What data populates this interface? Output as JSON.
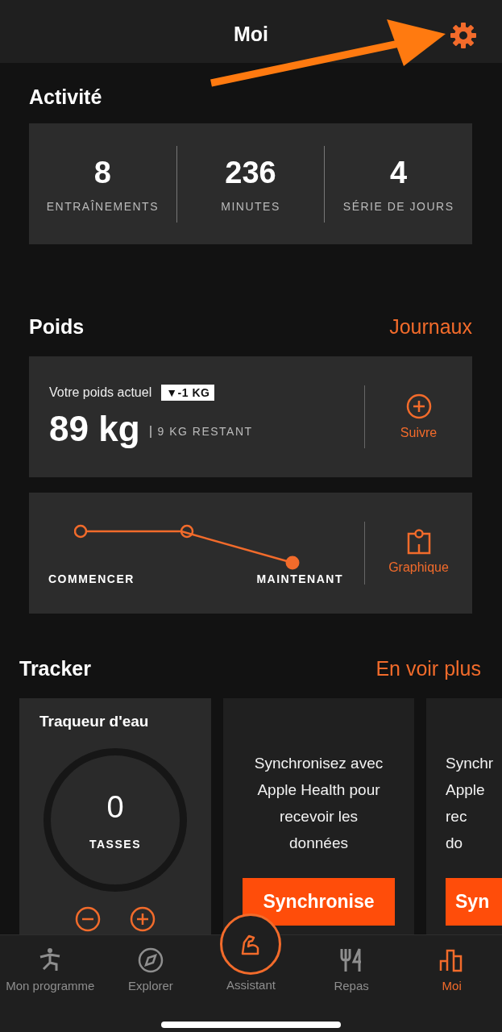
{
  "header": {
    "title": "Moi"
  },
  "activity": {
    "title": "Activité",
    "stats": [
      {
        "value": "8",
        "label": "ENTRAÎNEMENTS"
      },
      {
        "value": "236",
        "label": "MINUTES"
      },
      {
        "value": "4",
        "label": "SÉRIE DE JOURS"
      }
    ]
  },
  "weight": {
    "title": "Poids",
    "link": "Journaux",
    "current_label": "Votre poids actuel",
    "change_badge": "▼-1 KG",
    "value": "89 kg",
    "remaining": "9 KG RESTANT",
    "track_button": "Suivre",
    "progress_labels": [
      "COMMENCER",
      "MAINTENANT"
    ],
    "chart_button": "Graphique"
  },
  "tracker": {
    "title": "Tracker",
    "link": "En voir plus",
    "water": {
      "title": "Traqueur d'eau",
      "count": "0",
      "unit": "TASSES"
    },
    "sync_cards": [
      {
        "lines": [
          "Synchronisez avec",
          "Apple Health pour",
          "recevoir les",
          "données"
        ],
        "button": "Synchronise"
      },
      {
        "lines": [
          "Synchr",
          "Apple",
          "rec",
          "do"
        ],
        "button": "Syn"
      }
    ]
  },
  "tab_bar": [
    {
      "kind": "figure",
      "label": "Mon programme",
      "selected": false
    },
    {
      "kind": "compass",
      "label": "Explorer",
      "selected": false
    },
    {
      "kind": "assistant",
      "label": "Assistant",
      "selected": false
    },
    {
      "kind": "meals",
      "label": "Repas",
      "selected": false
    },
    {
      "kind": "chart",
      "label": "Moi",
      "selected": true
    }
  ]
}
